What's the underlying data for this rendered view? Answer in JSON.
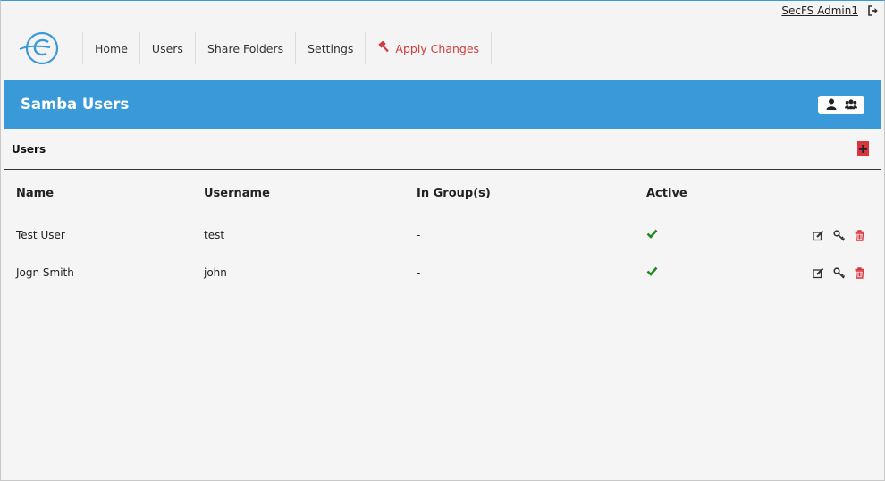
{
  "topbar": {
    "user": "SecFS Admin1",
    "logout_icon": "logout-icon"
  },
  "nav": {
    "items": [
      {
        "label": "Home"
      },
      {
        "label": "Users"
      },
      {
        "label": "Share Folders"
      },
      {
        "label": "Settings"
      }
    ],
    "apply": {
      "label": "Apply Changes",
      "icon": "gavel-icon",
      "color": "#d23b3b"
    }
  },
  "header": {
    "title": "Samba Users",
    "color": "#3a9ad9",
    "buttons": [
      "user-icon",
      "users-icon"
    ]
  },
  "panel": {
    "title": "Users",
    "add_icon": "plus-icon",
    "columns": [
      "Name",
      "Username",
      "In Group(s)",
      "Active"
    ],
    "rows": [
      {
        "name": "Test User",
        "username": "test",
        "groups": "-",
        "active": "check-icon"
      },
      {
        "name": "Jogn Smith",
        "username": "john",
        "groups": "-",
        "active": "check-icon"
      }
    ],
    "row_actions": [
      "edit-icon",
      "key-icon",
      "trash-icon"
    ]
  }
}
